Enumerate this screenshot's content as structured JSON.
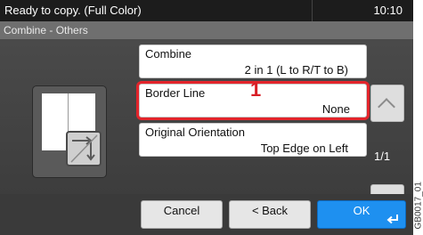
{
  "status": {
    "text": "Ready to copy. (Full Color)",
    "time": "10:10"
  },
  "title": "Combine - Others",
  "settings": [
    {
      "name": "Combine",
      "value": "2 in 1 (L to R/T to B)"
    },
    {
      "name": "Border Line",
      "value": "None"
    },
    {
      "name": "Original Orientation",
      "value": "Top Edge on Left"
    }
  ],
  "callout": "1",
  "page_indicator": "1/1",
  "buttons": {
    "cancel": "Cancel",
    "back": "< Back",
    "ok": "OK"
  },
  "figure_code": "GB0017_01",
  "colors": {
    "highlight": "#e3242b",
    "ok_button": "#1e90f0"
  }
}
